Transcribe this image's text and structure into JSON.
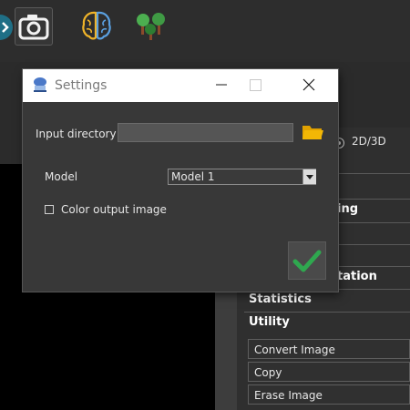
{
  "toolbar": {
    "buttons": [
      {
        "name": "camera-icon",
        "selected": true
      },
      {
        "name": "brain-icon",
        "selected": false
      },
      {
        "name": "trees-icon",
        "selected": false
      }
    ]
  },
  "right_panel": {
    "view_mode_label": "2D/3D",
    "sections": [
      "ing",
      "tation",
      "Statistics",
      "Utility"
    ],
    "utility_items": [
      "Convert Image",
      "Copy",
      "Erase Image"
    ]
  },
  "dialog": {
    "title": "Settings",
    "input_directory": {
      "label": "Input directory",
      "value": ""
    },
    "model": {
      "label": "Model",
      "selected": "Model 1"
    },
    "color_output": {
      "label": "Color output image",
      "checked": false
    },
    "ok_icon": "checkmark-icon",
    "folder_icon": "folder-icon",
    "accent_colors": {
      "folder": "#f2b705",
      "check": "#2fa84f"
    }
  }
}
